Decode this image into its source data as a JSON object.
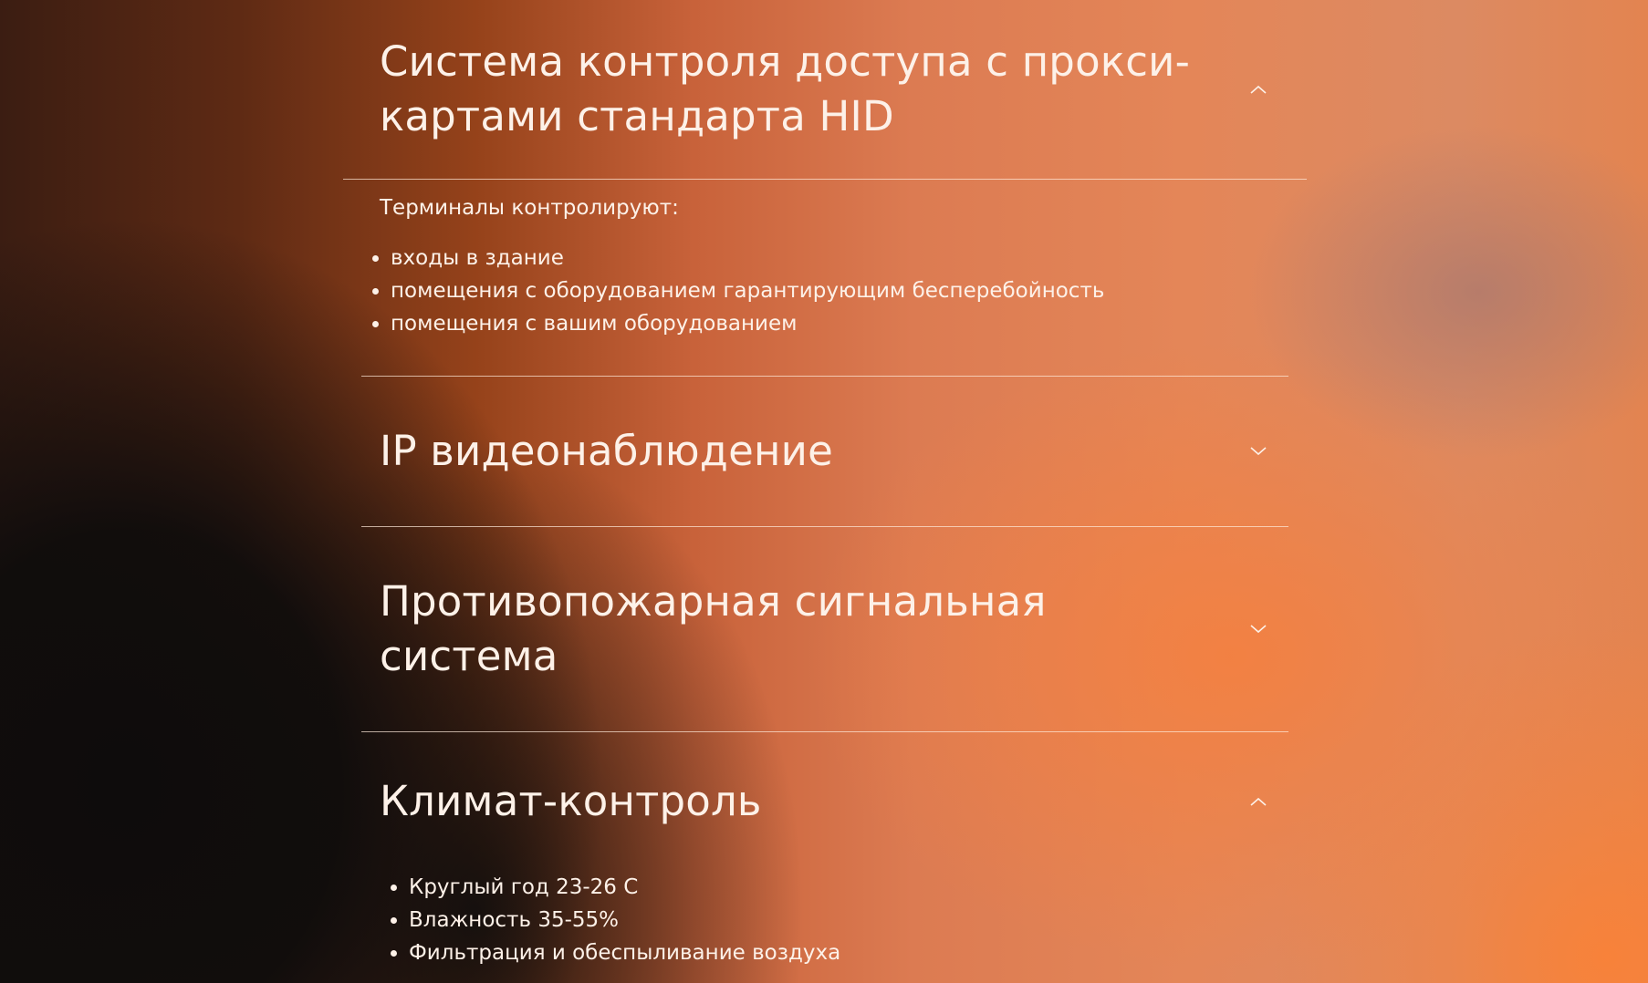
{
  "accordion": {
    "items": [
      {
        "title": "Система контроля доступа с прокси-картами стандарта HID",
        "expanded": true,
        "icon": "chevron-up-icon",
        "intro": "Терминалы контролируют:",
        "bullets": [
          "входы в здание",
          "помещения с оборудованием гарантирующим бесперебойность",
          "помещения с вашим оборудованием"
        ]
      },
      {
        "title": "IP видеонаблюдение",
        "expanded": false,
        "icon": "chevron-down-icon"
      },
      {
        "title": "Противопожарная сигнальная система",
        "expanded": false,
        "icon": "chevron-down-icon"
      },
      {
        "title": "Климат-контроль",
        "expanded": true,
        "icon": "chevron-up-icon",
        "bullets": [
          "Круглый год 23-26 С",
          "Влажность 35-55%",
          "Фильтрация и обеспыливание воздуха"
        ]
      }
    ]
  },
  "colors": {
    "text": "#fdf1e8",
    "divider": "#ffebdc",
    "accent_orange": "#f4803f",
    "dark": "#0e0c0c"
  }
}
